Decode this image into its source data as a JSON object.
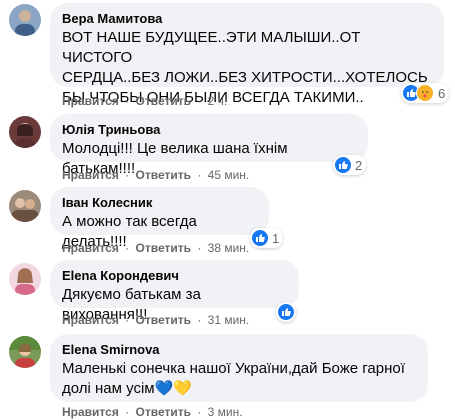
{
  "ui": {
    "like_label": "Нравится",
    "reply_label": "Ответить",
    "sep": "·"
  },
  "comments": [
    {
      "author": "Вера Мамитова",
      "text": "ВОТ НАШЕ БУДУЩЕЕ..ЭТИ МАЛЫШИ..ОТ ЧИСТОГО\nСЕРДЦА..БЕЗ ЛОЖИ..БЕЗ ХИТРОСТИ...ХОТЕЛОСЬ\nБЫ ЧТОБЫ ОНИ БЫЛИ ВСЕГДА ТАКИМИ..",
      "time": "2 ч.",
      "reactions": [
        "like-icon",
        "care-icon"
      ],
      "reaction_count": "6",
      "avatar_color": "#8aa6c4"
    },
    {
      "author": "Юлія Триньова",
      "text": "Молодці!!! Це велика шана їхнім батькам!!!!",
      "time": "45 мин.",
      "reactions": [
        "like-icon"
      ],
      "reaction_count": "2",
      "avatar_color": "#6b3a3a"
    },
    {
      "author": "Іван Колесник",
      "text": "А можно так всегда делать!!!!",
      "time": "38 мин.",
      "reactions": [
        "like-icon"
      ],
      "reaction_count": "1",
      "avatar_color": "#9c8a7a"
    },
    {
      "author": "Elena Корондевич",
      "text": "Дякуємо батькам за виховання!!!",
      "time": "31 мин.",
      "reactions": [
        "like-icon"
      ],
      "reaction_count": "",
      "avatar_color": "#d9a3b3"
    },
    {
      "author": "Elena Smirnova",
      "text": "Маленькі сонечка нашої України,дай Боже гарної\nдолі нам усім💙💛",
      "time": "3 мин.",
      "reactions": [],
      "reaction_count": "",
      "avatar_color": "#7a9a5a"
    }
  ]
}
